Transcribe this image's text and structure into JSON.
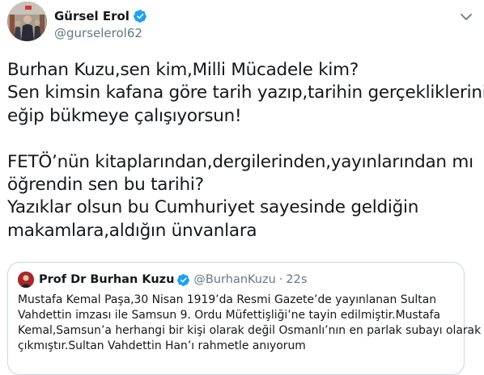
{
  "author": {
    "display_name": "Gürsel Erol",
    "handle": "@gurselerol62",
    "avatar": "avatar-photo",
    "verified_icon": "verified-badge-icon"
  },
  "menu_icon": "chevron-down-icon",
  "tweet": {
    "lines": [
      "Burhan Kuzu,sen kim,Milli Mücadele kim?",
      "Sen kimsin kafana göre tarih yazıp,tarihin gerçekliklerini",
      "eğip bükmeye çalışıyorsun!",
      "",
      "FETÖ’nün kitaplarından,dergilerinden,yayınlarından mı",
      "öğrendin sen bu tarihi?",
      "Yazıklar olsun bu Cumhuriyet sayesinde geldiğin",
      "makamlara,aldığın ünvanlara"
    ]
  },
  "quoted": {
    "display_name": "Prof Dr Burhan Kuzu",
    "handle": "@BurhanKuzu",
    "separator": "·",
    "time": "22s",
    "lines": [
      "Mustafa Kemal Paşa,30 Nisan 1919’da Resmi Gazete’de yayınlanan Sultan",
      "Vahdettin imzası ile Samsun 9. Ordu Müfettişliği’ne tayin edilmiştir.Mustafa",
      "Kemal,Samsun’a herhangi bir kişi olarak değil Osmanlı’nın en parlak subayı olarak",
      "çıkmıştır.Sultan Vahdettin Han’ı rahmetle anıyorum"
    ]
  },
  "colors": {
    "verified": "#1da1f2",
    "secondary_text": "#657786",
    "primary_text": "#14171a",
    "border": "#ccd6dd"
  }
}
